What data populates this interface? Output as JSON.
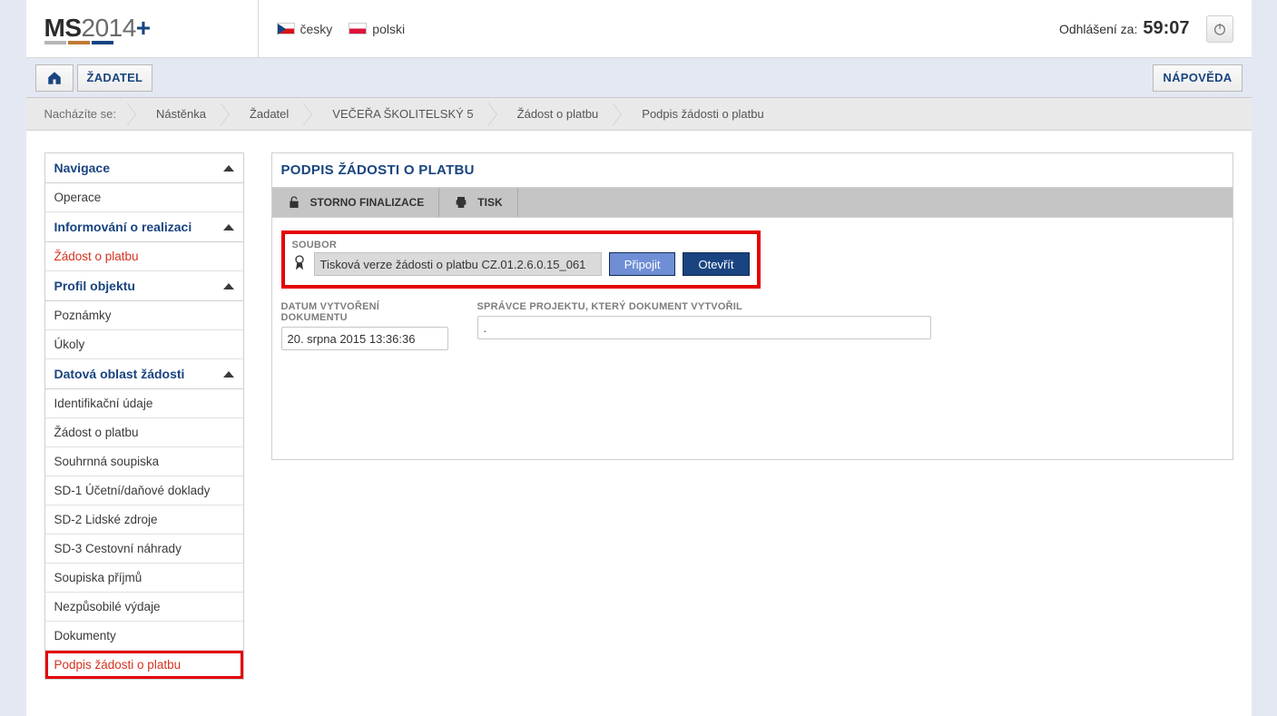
{
  "logo": {
    "prefix": "MS",
    "year": "2014",
    "plus": "+"
  },
  "languages": [
    {
      "code": "cz",
      "label": "česky"
    },
    {
      "code": "pl",
      "label": "polski"
    }
  ],
  "logout": {
    "label": "Odhlášení za:",
    "time": "59:07"
  },
  "navbar": {
    "applicant": "ŽADATEL",
    "help": "NÁPOVĚDA"
  },
  "breadcrumb": {
    "lead": "Nacházíte se:",
    "items": [
      "Nástěnka",
      "Žadatel",
      "VEČEŘA ŠKOLITELSKÝ 5",
      "Žádost o platbu",
      "Podpis žádosti o platbu"
    ]
  },
  "sidebar": {
    "sections": [
      {
        "title": "Navigace",
        "items": [
          "Operace"
        ]
      },
      {
        "title": "Informování o realizaci",
        "items": [
          {
            "label": "Žádost o platbu",
            "active": true
          }
        ]
      },
      {
        "title": "Profil objektu",
        "items": [
          "Poznámky",
          "Úkoly"
        ]
      },
      {
        "title": "Datová oblast žádosti",
        "items": [
          "Identifikační údaje",
          "Žádost o platbu",
          "Souhrnná soupiska",
          "SD-1 Účetní/daňové doklady",
          "SD-2 Lidské zdroje",
          "SD-3 Cestovní náhrady",
          "Soupiska příjmů",
          "Nezpůsobilé výdaje",
          "Dokumenty",
          {
            "label": "Podpis žádosti o platbu",
            "highlight": true
          }
        ]
      }
    ]
  },
  "main": {
    "title": "PODPIS ŽÁDOSTI O PLATBU",
    "toolbar": {
      "storno": "STORNO FINALIZACE",
      "print": "TISK"
    },
    "form": {
      "soubor_label": "SOUBOR",
      "file_name": "Tisková verze žádosti o platbu CZ.01.2.6.0.15_061",
      "btn_attach": "Připojit",
      "btn_open": "Otevřít",
      "date_label": "DATUM VYTVOŘENÍ DOKUMENTU",
      "date_value": "20. srpna 2015 13:36:36",
      "admin_label": "SPRÁVCE PROJEKTU, KTERÝ DOKUMENT VYTVOŘIL",
      "admin_value": "."
    }
  }
}
